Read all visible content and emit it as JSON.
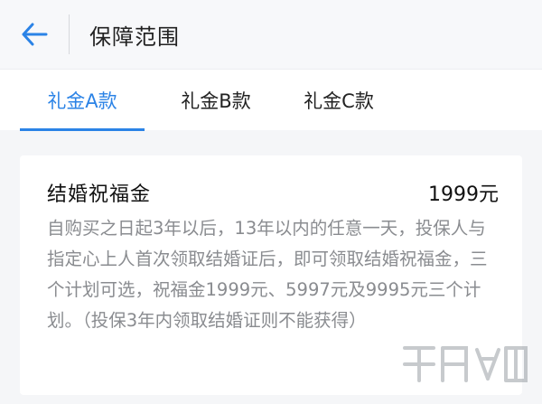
{
  "header": {
    "title": "保障范围"
  },
  "tabs": [
    {
      "label": "礼金A款",
      "active": true
    },
    {
      "label": "礼金B款",
      "active": false
    },
    {
      "label": "礼金C款",
      "active": false
    }
  ],
  "card": {
    "title": "结婚祝福金",
    "amount": "1999元",
    "description": "自购买之日起3年以后，13年以内的任意一天，投保人与指定心上人首次领取结婚证后，即可领取结婚祝福金，三个计划可选，祝福金1999元、5997元及9995元三个计划。（投保3年内领取结婚证则不能获得）"
  },
  "colors": {
    "accent": "#2b83e6",
    "muted_text": "#8a8c90"
  }
}
